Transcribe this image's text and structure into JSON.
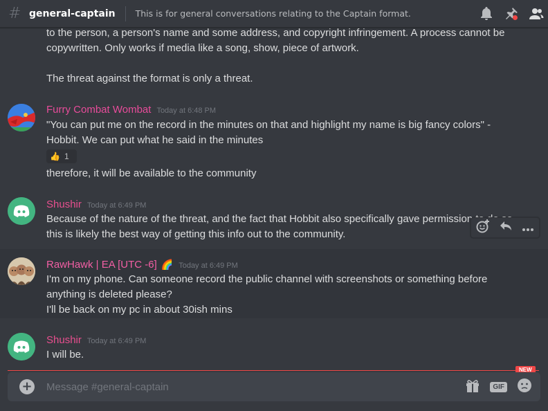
{
  "header": {
    "channel_name": "general-captain",
    "topic": "This is for general conversations relating to the Captain format."
  },
  "messages": [
    {
      "continuation": true,
      "lines": [
        "to the person, a person's name and some address, and copyright infringement. A process cannot be",
        "copywritten. Only works if media like a song, show, piece of artwork.",
        "",
        "The threat against the format is only a threat."
      ]
    },
    {
      "author": "Furry Combat Wombat",
      "timestamp": "Today at 6:48 PM",
      "lines": [
        "\"You can put me on the record in the minutes on that and highlight my name is big fancy colors\" -",
        "Hobbit. We can put what he said in the minutes"
      ],
      "reaction": {
        "emoji": "👍",
        "count": "1"
      },
      "after_reaction": "therefore, it will be available to the community"
    },
    {
      "author": "Shushir",
      "timestamp": "Today at 6:49 PM",
      "lines": [
        "Because of the nature of the threat, and the fact that Hobbit also specifically gave permission to do so,",
        "this is likely the best way of getting this info out to the community."
      ]
    },
    {
      "author": "RawHawk | EA [UTC -6]",
      "author_emoji": "🌈",
      "timestamp": "Today at 6:49 PM",
      "lines": [
        "I'm on my phone. Can someone record the public channel with screenshots or something before",
        "anything is deleted please?",
        "I'll be back on my pc in about 30ish mins"
      ]
    },
    {
      "author": "Shushir",
      "timestamp": "Today at 6:49 PM",
      "lines": [
        "I will be."
      ]
    }
  ],
  "new_badge": "NEW",
  "composer": {
    "placeholder": "Message #general-captain",
    "gif_label": "GIF"
  },
  "icons": [
    "bell-icon",
    "pin-icon",
    "members-icon",
    "add-reaction-icon",
    "reply-icon",
    "more-icon",
    "plus-icon",
    "gift-icon",
    "gif-icon",
    "emoji-icon"
  ]
}
